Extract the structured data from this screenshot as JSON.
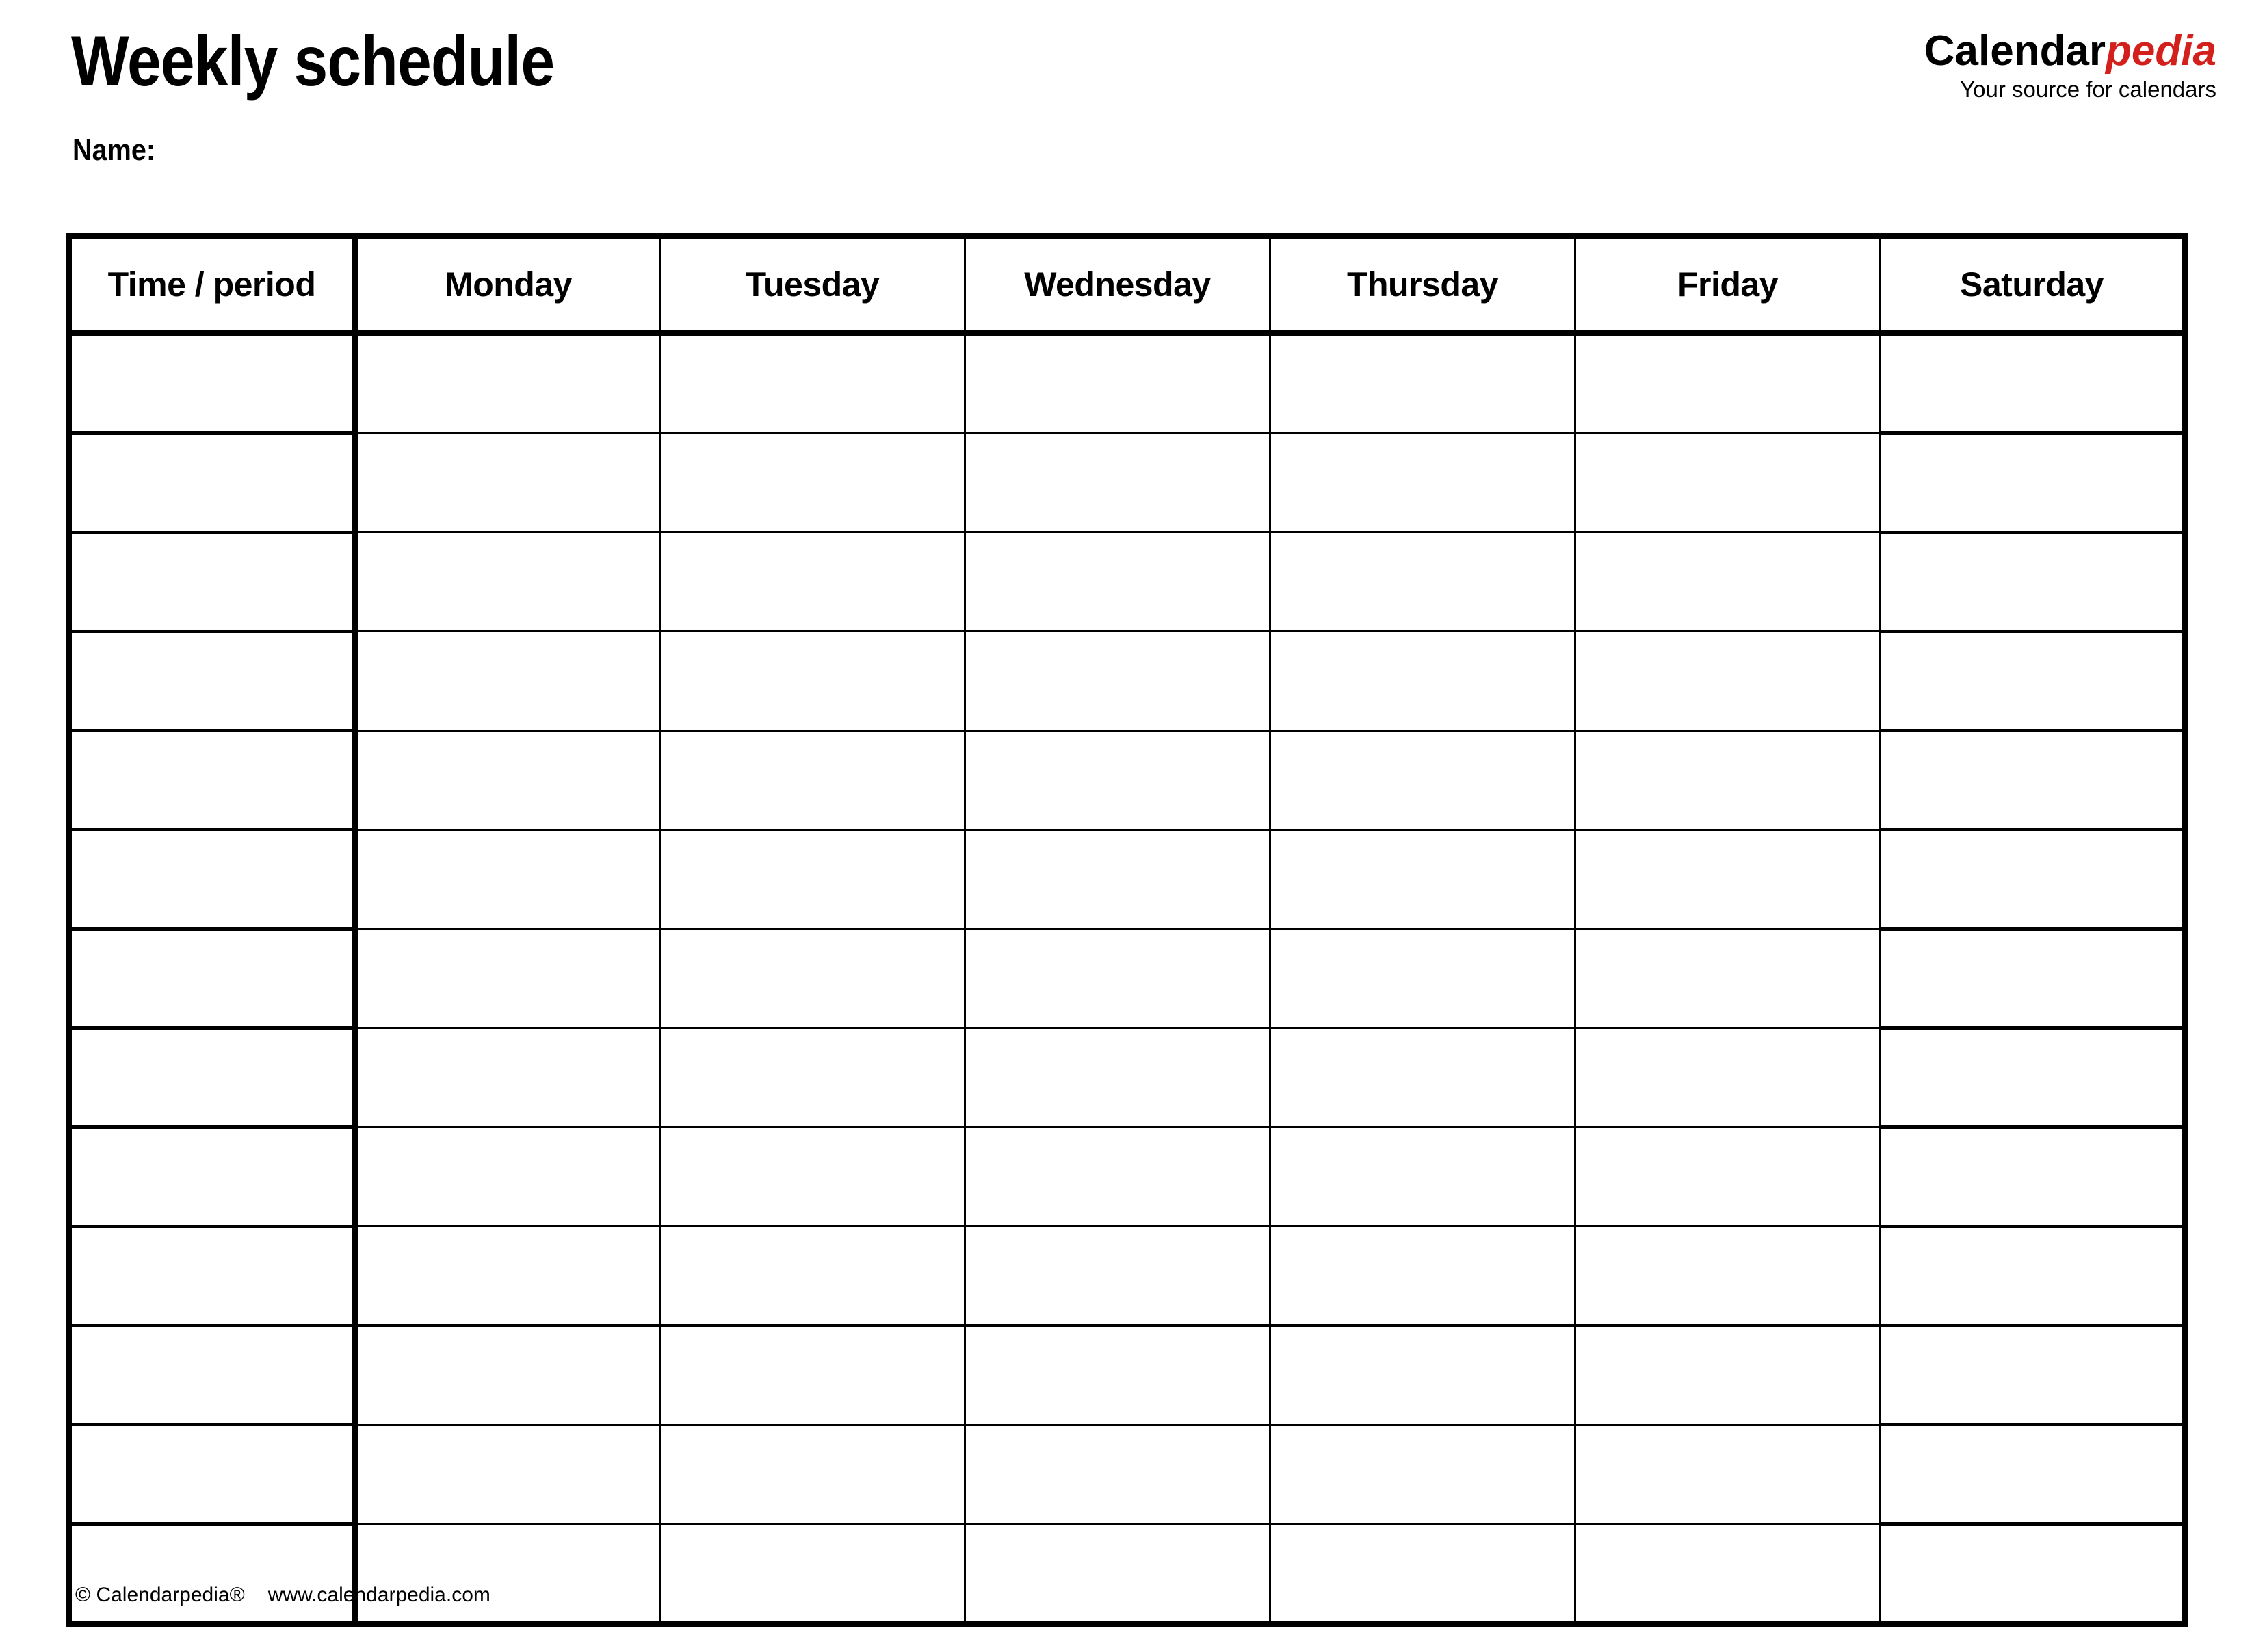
{
  "document": {
    "title": "Weekly schedule",
    "name_label": "Name:"
  },
  "brand": {
    "name_part_one": "Calendar",
    "name_part_two": "pedia",
    "tagline": "Your source for calendars",
    "accent_color": "#D4201C",
    "text_color": "#000000"
  },
  "schedule": {
    "columns": [
      "Time / period",
      "Monday",
      "Tuesday",
      "Wednesday",
      "Thursday",
      "Friday",
      "Saturday"
    ],
    "row_count": 13,
    "rows": [
      [
        "",
        "",
        "",
        "",
        "",
        "",
        ""
      ],
      [
        "",
        "",
        "",
        "",
        "",
        "",
        ""
      ],
      [
        "",
        "",
        "",
        "",
        "",
        "",
        ""
      ],
      [
        "",
        "",
        "",
        "",
        "",
        "",
        ""
      ],
      [
        "",
        "",
        "",
        "",
        "",
        "",
        ""
      ],
      [
        "",
        "",
        "",
        "",
        "",
        "",
        ""
      ],
      [
        "",
        "",
        "",
        "",
        "",
        "",
        ""
      ],
      [
        "",
        "",
        "",
        "",
        "",
        "",
        ""
      ],
      [
        "",
        "",
        "",
        "",
        "",
        "",
        ""
      ],
      [
        "",
        "",
        "",
        "",
        "",
        "",
        ""
      ],
      [
        "",
        "",
        "",
        "",
        "",
        "",
        ""
      ],
      [
        "",
        "",
        "",
        "",
        "",
        "",
        ""
      ],
      [
        "",
        "",
        "",
        "",
        "",
        "",
        ""
      ]
    ]
  },
  "footer": {
    "copyright": "© Calendarpedia®",
    "website": "www.calendarpedia.com"
  }
}
